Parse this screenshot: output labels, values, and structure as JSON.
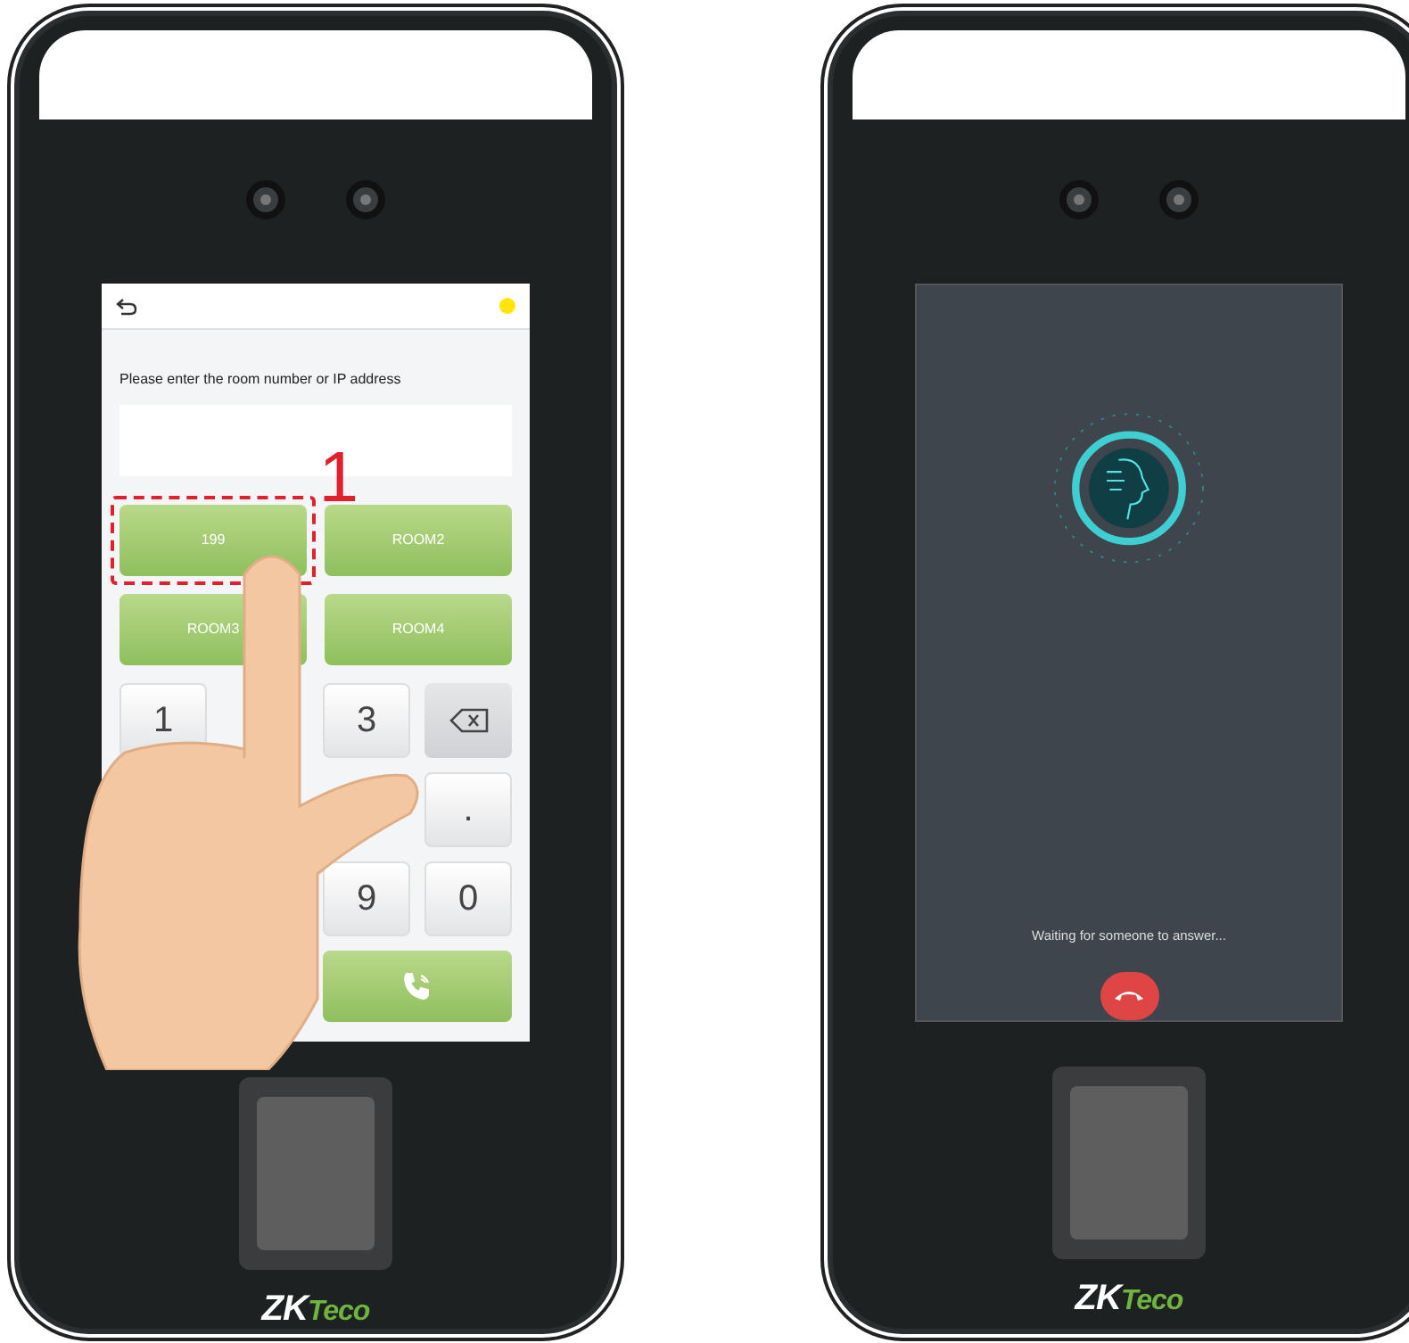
{
  "devices": [
    {
      "kind": "dial",
      "screen": {
        "prompt": "Please enter the room number or IP address",
        "rooms": [
          {
            "label": "199",
            "highlighted": true
          },
          {
            "label": "ROOM2",
            "highlighted": false
          },
          {
            "label": "ROOM3",
            "highlighted": false
          },
          {
            "label": "ROOM4",
            "highlighted": false
          }
        ],
        "keys": [
          {
            "kind": "digit",
            "label": "1"
          },
          {
            "kind": "blank"
          },
          {
            "kind": "digit",
            "label": "3"
          },
          {
            "kind": "backspace"
          },
          {
            "kind": "blank"
          },
          {
            "kind": "blank"
          },
          {
            "kind": "blank"
          },
          {
            "kind": "digit",
            "label": "."
          },
          {
            "kind": "blank"
          },
          {
            "kind": "blank"
          },
          {
            "kind": "digit",
            "label": "9"
          },
          {
            "kind": "digit",
            "label": "0"
          },
          {
            "kind": "blank"
          },
          {
            "kind": "blank"
          },
          {
            "kind": "call"
          }
        ],
        "step": "1"
      },
      "logo": {
        "main": "ZK",
        "accent": "Teco"
      }
    },
    {
      "kind": "calling",
      "screen": {
        "status": "Waiting for someone to answer..."
      },
      "logo": {
        "main": "ZK",
        "accent": "Teco"
      }
    }
  ]
}
